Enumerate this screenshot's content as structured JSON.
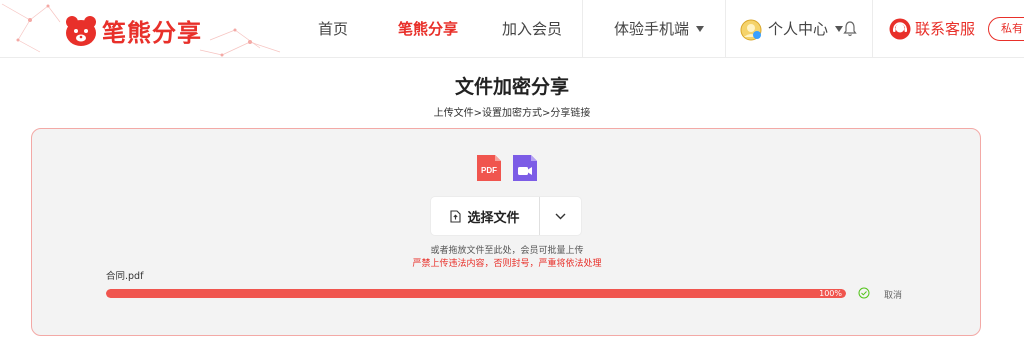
{
  "brand": {
    "name": "笔熊分享",
    "color": "#e8302a"
  },
  "nav": {
    "home": "首页",
    "share": "笔熊分享",
    "join": "加入会员",
    "mobile": "体验手机端",
    "user_center": "个人中心",
    "customer_service": "联系客服",
    "private_tag": "私有"
  },
  "page": {
    "title": "文件加密分享",
    "breadcrumb": "上传文件>设置加密方式>分享链接"
  },
  "upload": {
    "filetype_badges": [
      "PDF",
      "video-icon"
    ],
    "select_button": "选择文件",
    "hint": "或者拖放文件至此处，会员可批量上传",
    "warning": "严禁上传违法内容，否则封号，严重将依法处理",
    "file_name": "合同.pdf",
    "progress": 1.0,
    "progress_label": "100%",
    "cancel": "取消"
  },
  "colors": {
    "accent": "#e8302a",
    "progress": "#f0554e",
    "success": "#52c41a",
    "video_badge": "#7c5ce6"
  }
}
